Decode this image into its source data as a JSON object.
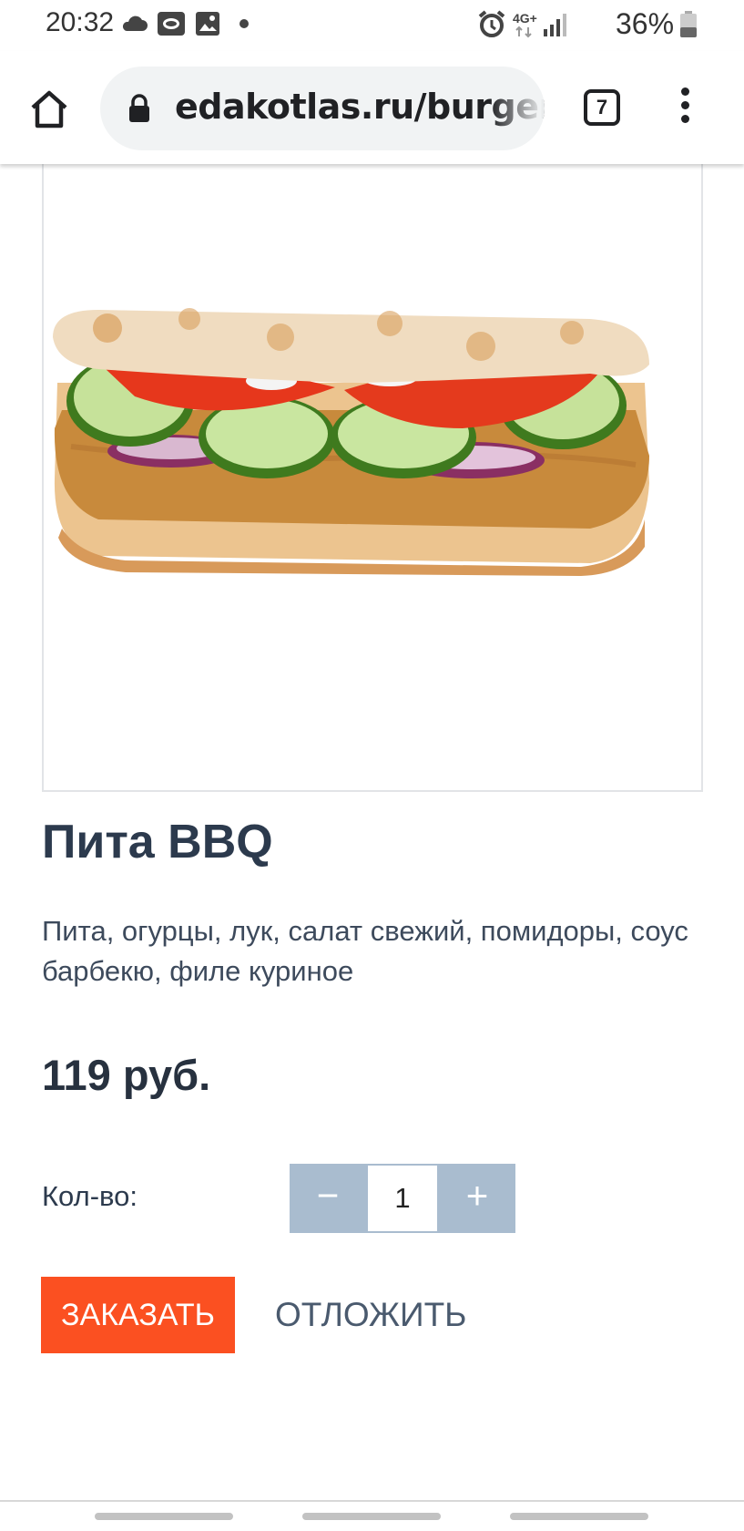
{
  "status_bar": {
    "time": "20:32",
    "network": "4G+",
    "battery": "36%"
  },
  "browser": {
    "url": "edakotlas.ru/burger",
    "tab_count": "7"
  },
  "product": {
    "title": "Пита BBQ",
    "description": "Пита, огурцы, лук, салат свежий, помидоры, соус барбекю, филе куриное",
    "price": "119 руб.",
    "quantity_label": "Кол-во:",
    "quantity": "1",
    "minus": "−",
    "plus": "+",
    "order_label": "ЗАКАЗАТЬ",
    "defer_label": "ОТЛОЖИТЬ"
  },
  "colors": {
    "order_button": "#fb5021",
    "qty_button": "#a9bccf",
    "title": "#2c3a4d"
  }
}
